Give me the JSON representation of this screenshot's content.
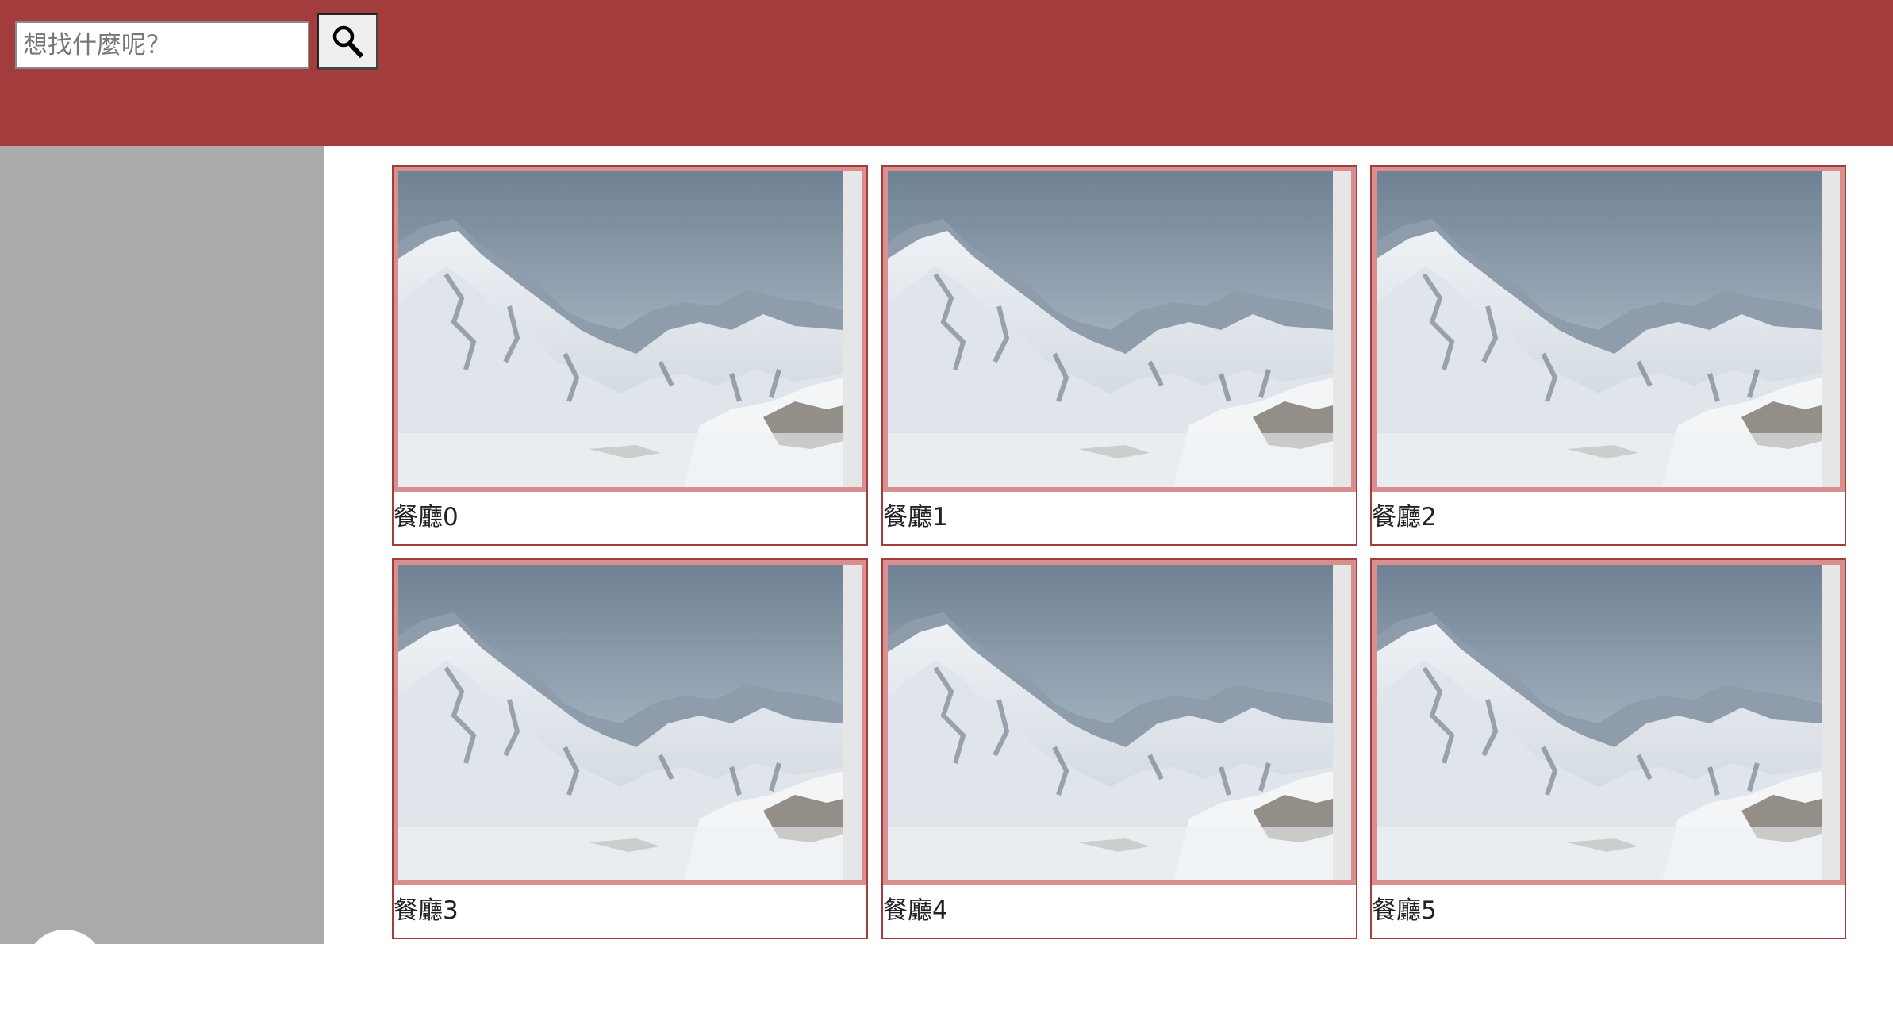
{
  "header": {
    "search_placeholder": "想找什麼呢？",
    "search_button_icon": "search-icon"
  },
  "colors": {
    "header_bg": "#a33c3c",
    "sidebar_bg": "#aaaaaa",
    "card_border": "#a33c3c"
  },
  "cards": [
    {
      "label": "餐廳0",
      "image": "snowy-mountain"
    },
    {
      "label": "餐廳1",
      "image": "snowy-mountain"
    },
    {
      "label": "餐廳2",
      "image": "snowy-mountain"
    },
    {
      "label": "餐廳3",
      "image": "snowy-mountain"
    },
    {
      "label": "餐廳4",
      "image": "snowy-mountain"
    },
    {
      "label": "餐廳5",
      "image": "snowy-mountain"
    }
  ]
}
